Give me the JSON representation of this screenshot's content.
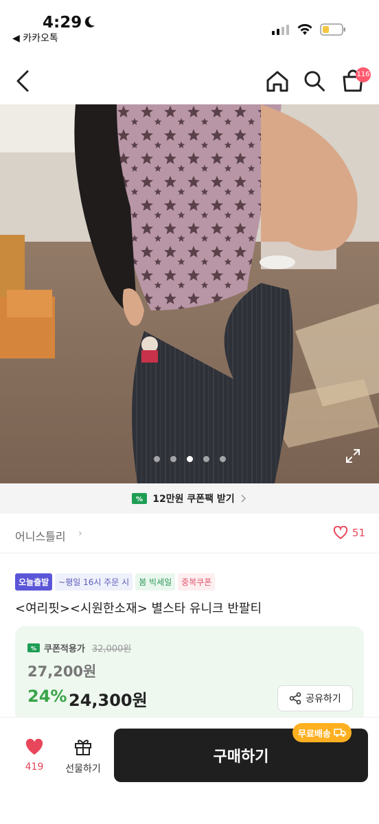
{
  "status_bar": {
    "time": "4:29",
    "back_app": "◀ 카카오톡"
  },
  "nav": {
    "cart_count": "116"
  },
  "gallery": {
    "dot_count": 5,
    "active_index": 2
  },
  "coupon_bar": {
    "label": "12만원 쿠폰팩 받기"
  },
  "seller": {
    "name": "어니스틀리",
    "likes": "51"
  },
  "badges": [
    "오늘출발",
    "~평일 16시 주문 시",
    "봄 빅세일",
    "중복쿠폰"
  ],
  "product": {
    "title": "<여리핏><시원한소재> 별스타 유니크 반팔티"
  },
  "price": {
    "coupon_label": "쿠폰적용가",
    "original_price": "32,000원",
    "coupon_price": "27,200원",
    "discount": "24%",
    "final_price": "24,300원",
    "share_label": "공유하기"
  },
  "bottom_bar": {
    "wish_count": "419",
    "gift_label": "선물하기",
    "buy_label": "구매하기",
    "shipping_badge": "무료배송"
  },
  "colors": {
    "accent_green": "#3aa44a",
    "heart_red": "#e8465a",
    "buy_dark": "#1f1f1f",
    "shipping_orange": "#ffb021"
  }
}
